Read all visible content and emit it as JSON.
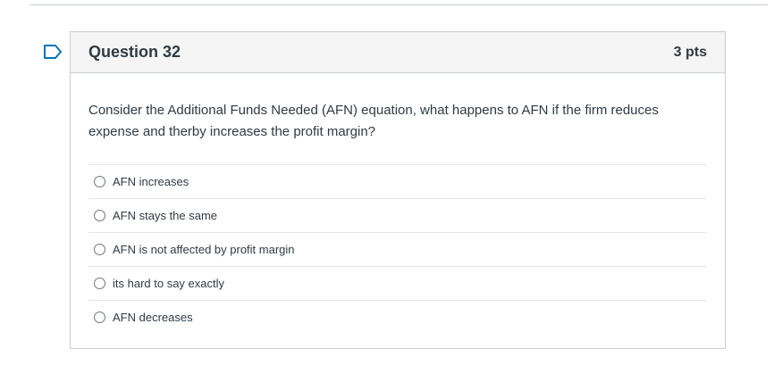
{
  "question": {
    "title": "Question 32",
    "points": "3 pts",
    "text": "Consider the Additional Funds Needed (AFN) equation, what happens to AFN if the firm reduces expense and therby increases the profit margin?",
    "answers": [
      {
        "label": "AFN increases"
      },
      {
        "label": "AFN stays the same"
      },
      {
        "label": "AFN is not affected by profit margin"
      },
      {
        "label": "its hard to say exactly"
      },
      {
        "label": "AFN decreases"
      }
    ]
  },
  "colors": {
    "flag": "#0374b5",
    "header_bg": "#f5f5f5",
    "border": "#c7cdd1",
    "text": "#2d3b45"
  },
  "icons": {
    "flag": "flag-icon",
    "radio": "radio-button"
  }
}
